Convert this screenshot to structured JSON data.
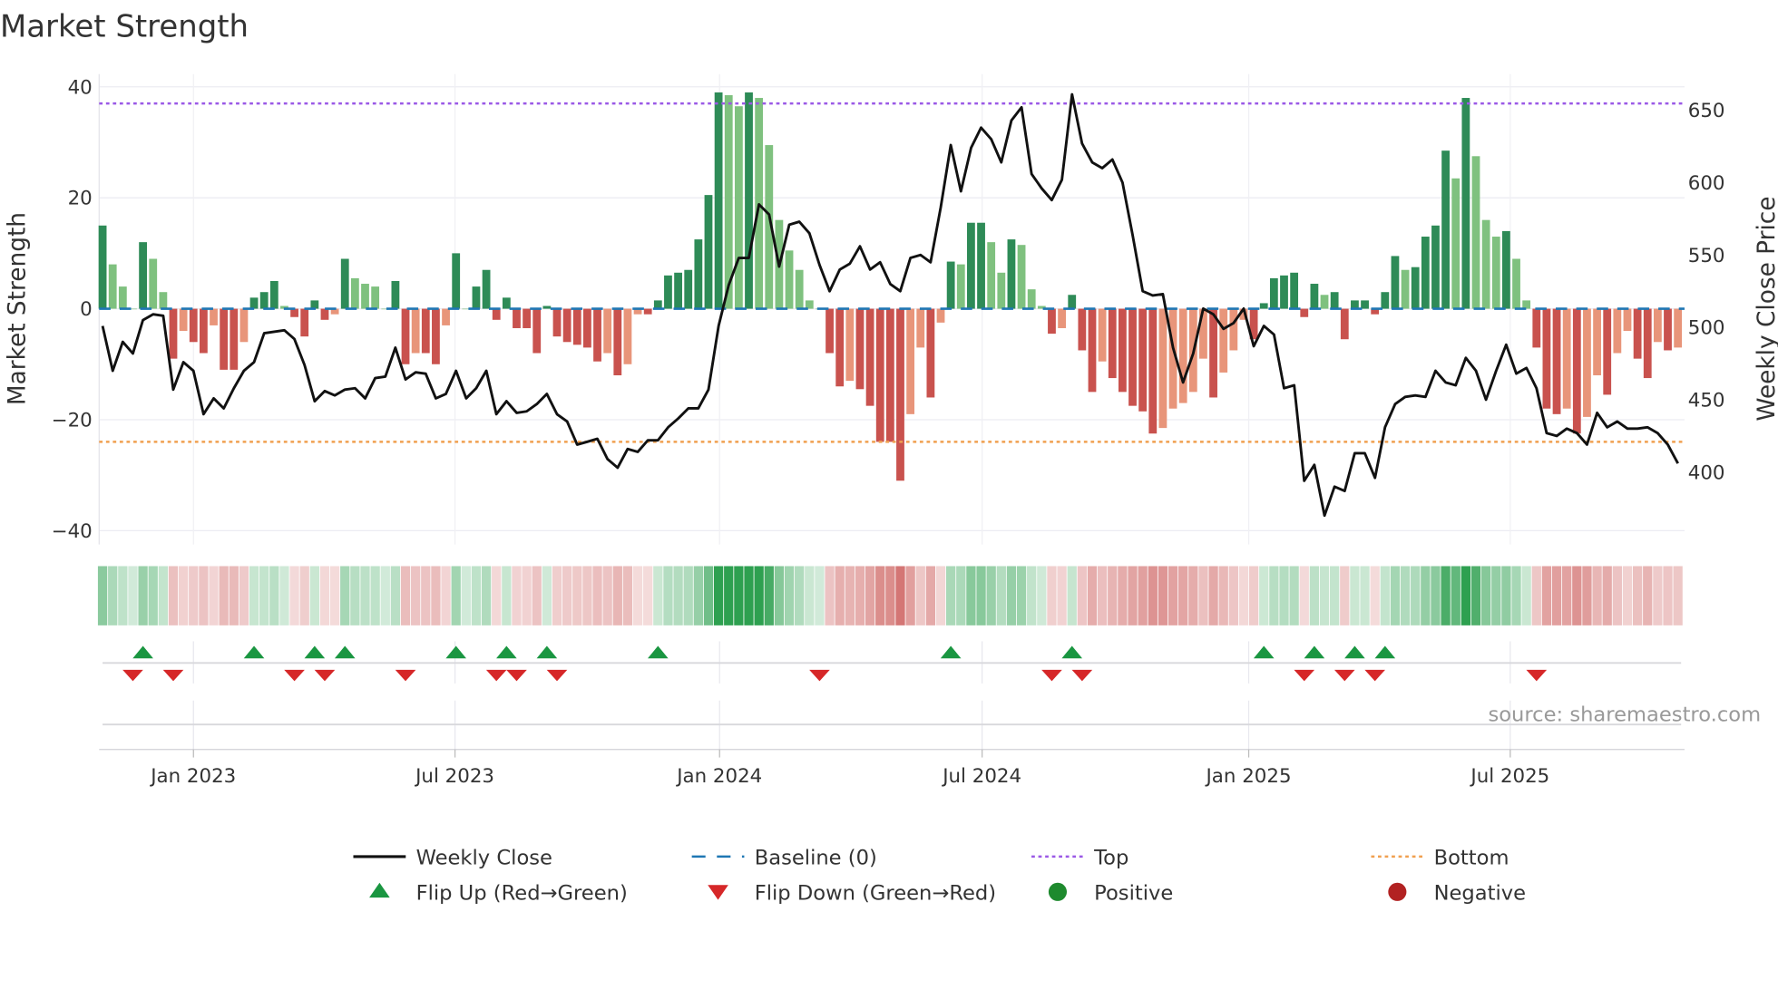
{
  "chart_data": {
    "type": "bar",
    "title": "Market Strength",
    "ylabel": "Market Strength",
    "y2label": "Weekly Close Price",
    "ylim": [
      -42.5,
      42.3
    ],
    "y2lim": [
      350,
      675
    ],
    "yticks": [
      "40",
      "20",
      "0",
      "−20",
      "−40"
    ],
    "ytick_values": [
      40,
      20,
      0,
      -20,
      -40
    ],
    "y2ticks": [
      "650",
      "600",
      "550",
      "500",
      "450",
      "400"
    ],
    "y2tick_values": [
      650,
      600,
      550,
      500,
      450,
      400
    ],
    "first_week": "2022-10-31",
    "xticks": [
      {
        "label": "Jan 2023",
        "week": 9
      },
      {
        "label": "Jul 2023",
        "week": 34.9
      },
      {
        "label": "Jan 2024",
        "week": 61.1
      },
      {
        "label": "Jul 2024",
        "week": 87.1
      },
      {
        "label": "Jan 2025",
        "week": 113.5
      },
      {
        "label": "Jul 2025",
        "week": 139.4
      }
    ],
    "top": 37,
    "bottom": -24,
    "strength": [
      15,
      8,
      4,
      0,
      12,
      9,
      3,
      -9,
      -4,
      -6,
      -8,
      -3,
      -11,
      -11,
      -6,
      2,
      3,
      5,
      0.5,
      -1.5,
      -5,
      1.5,
      -2,
      -1,
      9,
      5.5,
      4.5,
      4,
      0,
      5,
      -10,
      -8,
      -8,
      -10,
      -3,
      10,
      0,
      4,
      7,
      -2,
      2,
      -3.5,
      -3.5,
      -8,
      0.5,
      -5,
      -6,
      -6.5,
      -7,
      -9.5,
      -8,
      -12,
      -10,
      -1,
      -1,
      1.5,
      6,
      6.5,
      7,
      12.5,
      20.5,
      39,
      38.5,
      36.5,
      39,
      38,
      29.5,
      16,
      10.5,
      7,
      1.5,
      0,
      -8,
      -14,
      -13,
      -14.5,
      -17.5,
      -24,
      -24,
      -31,
      -19,
      -7,
      -16,
      -2.5,
      8.5,
      8,
      15.5,
      15.5,
      12,
      6.5,
      12.5,
      11.5,
      3.5,
      0.5,
      -4.5,
      -3.5,
      2.5,
      -7.5,
      -15,
      -9.5,
      -12.5,
      -15,
      -17.5,
      -18.5,
      -22.5,
      -21.5,
      -18,
      -17,
      -15,
      -9,
      -16,
      -11.5,
      -7.5,
      -2,
      -5.5,
      1,
      5.5,
      6,
      6.5,
      -1.5,
      4.5,
      2.5,
      3,
      -5.5,
      1.5,
      1.5,
      -1,
      3,
      9.5,
      7,
      7.5,
      13,
      15,
      28.5,
      23.5,
      38,
      27.5,
      16,
      13,
      14,
      9,
      1.5,
      -7,
      -18,
      -19,
      -18,
      -22.5,
      -19.5,
      -12,
      -15.5,
      -8,
      -4,
      -9,
      -12.5,
      -6,
      -7.5,
      -7
    ],
    "weekly_close": [
      501,
      470,
      490,
      482,
      505,
      509,
      508,
      457,
      476,
      470,
      440,
      451,
      444,
      458,
      470,
      476,
      496,
      497,
      498,
      492,
      474,
      449,
      456,
      453,
      457,
      458,
      451,
      465,
      466,
      486,
      464,
      469,
      468,
      451,
      454,
      470,
      451,
      458,
      470,
      440,
      449,
      441,
      442,
      447,
      454,
      440,
      435,
      419,
      421,
      423,
      409,
      403,
      416,
      414,
      422,
      422,
      431,
      437,
      444,
      444,
      457,
      501,
      529,
      548,
      548,
      585,
      578,
      542,
      571,
      573,
      565,
      543,
      525,
      540,
      544,
      556,
      540,
      545,
      530,
      525,
      548,
      550,
      545,
      583,
      626,
      594,
      624,
      638,
      630,
      614,
      643,
      652,
      606,
      596,
      588,
      602,
      661,
      627,
      614,
      610,
      616,
      600,
      564,
      525,
      522,
      523,
      486,
      462,
      482,
      513,
      509,
      499,
      503,
      513,
      487,
      501,
      495,
      458,
      460,
      394,
      405,
      370,
      390,
      387,
      413,
      413,
      396,
      431,
      447,
      452,
      453,
      452,
      470,
      462,
      460,
      479,
      470,
      450,
      470,
      488,
      468,
      472,
      458,
      427,
      425,
      430,
      427,
      419,
      441,
      431,
      435,
      430,
      430,
      431,
      427,
      419,
      406
    ],
    "flip_up_weeks": [
      4,
      15,
      21,
      24,
      35,
      40,
      44,
      55,
      84,
      96,
      115,
      120,
      124,
      127
    ],
    "flip_down_weeks": [
      3,
      7,
      19,
      22,
      30,
      39,
      41,
      45,
      71,
      94,
      97,
      119,
      123,
      126,
      142
    ],
    "legend": [
      {
        "label": "Weekly Close",
        "kind": "line",
        "color": "#111111"
      },
      {
        "label": "Baseline (0)",
        "kind": "dash",
        "color": "#1f77b4"
      },
      {
        "label": "Top",
        "kind": "dot",
        "color": "#9b59e6"
      },
      {
        "label": "Bottom",
        "kind": "dot",
        "color": "#f0a050"
      },
      {
        "label": "Flip Up (Red→Green)",
        "kind": "up",
        "color": "#1a9641"
      },
      {
        "label": "Flip Down (Green→Red)",
        "kind": "down",
        "color": "#d62728"
      },
      {
        "label": "Positive",
        "kind": "circle",
        "color": "#1e8a2e"
      },
      {
        "label": "Negative",
        "kind": "circle",
        "color": "#b22222"
      }
    ],
    "source": "source: sharemaestro.com"
  },
  "colors": {
    "pos_dark": "#2e8b57",
    "pos_light": "#7fc17f",
    "neg_dark": "#c9524e",
    "neg_light": "#e8957a"
  }
}
